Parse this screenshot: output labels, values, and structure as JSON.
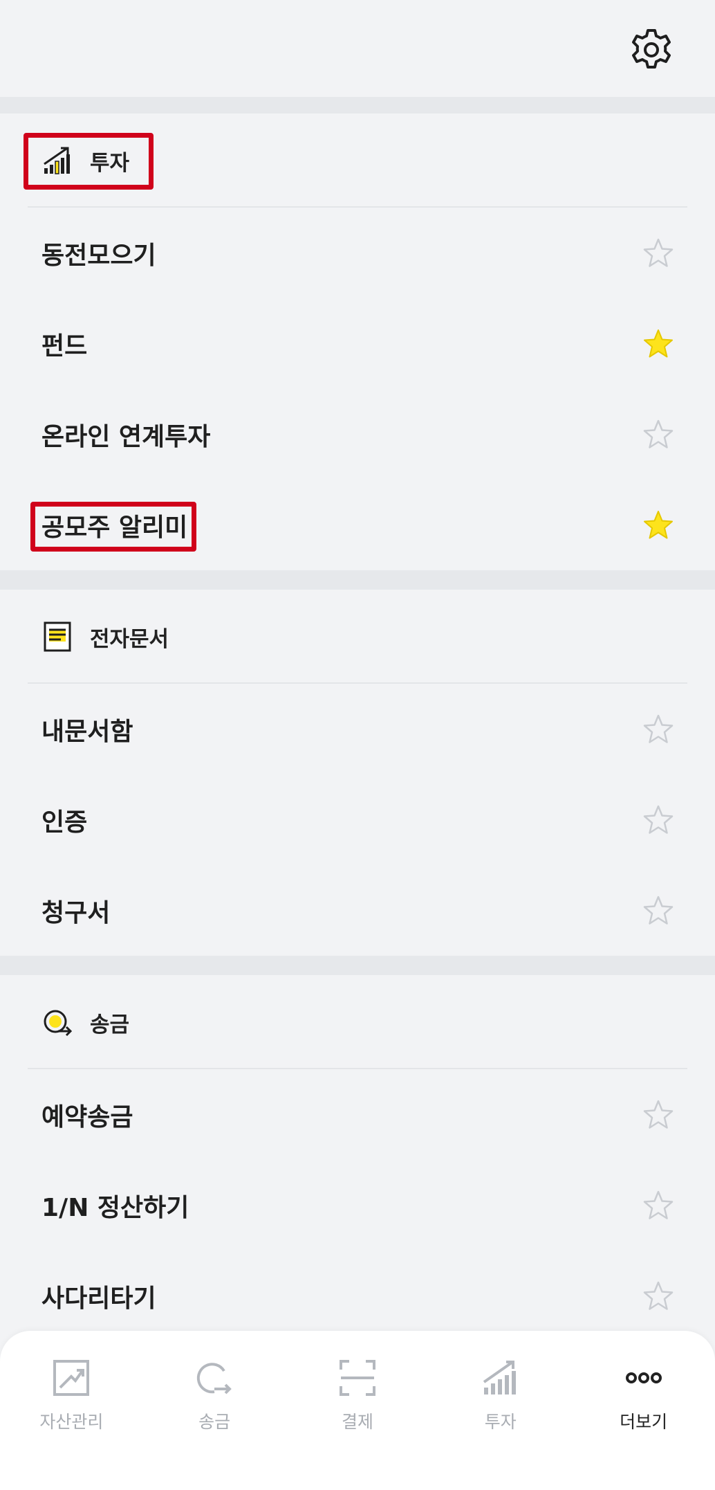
{
  "sections": {
    "invest": {
      "title": "투자",
      "items": [
        {
          "label": "동전모으기",
          "starred": false
        },
        {
          "label": "펀드",
          "starred": true
        },
        {
          "label": "온라인 연계투자",
          "starred": false
        },
        {
          "label": "공모주 알리미",
          "starred": true
        }
      ]
    },
    "documents": {
      "title": "전자문서",
      "items": [
        {
          "label": "내문서함",
          "starred": false
        },
        {
          "label": "인증",
          "starred": false
        },
        {
          "label": "청구서",
          "starred": false
        }
      ]
    },
    "transfer": {
      "title": "송금",
      "items": [
        {
          "label": "예약송금",
          "starred": false
        },
        {
          "label": "1/N 정산하기",
          "starred": false
        },
        {
          "label": "사다리타기",
          "starred": false
        }
      ]
    }
  },
  "bottom_nav": {
    "items": [
      {
        "label": "자산관리",
        "icon": "asset-chart-icon",
        "active": false
      },
      {
        "label": "송금",
        "icon": "transfer-icon",
        "active": false
      },
      {
        "label": "결제",
        "icon": "scan-icon",
        "active": false
      },
      {
        "label": "투자",
        "icon": "invest-bars-icon",
        "active": false
      },
      {
        "label": "더보기",
        "icon": "more-dots-icon",
        "active": true
      }
    ]
  },
  "colors": {
    "star_active": "#fde31c",
    "star_inactive": "#c9ccd1",
    "highlight": "#d0021b",
    "accent_yellow": "#fde31c"
  }
}
